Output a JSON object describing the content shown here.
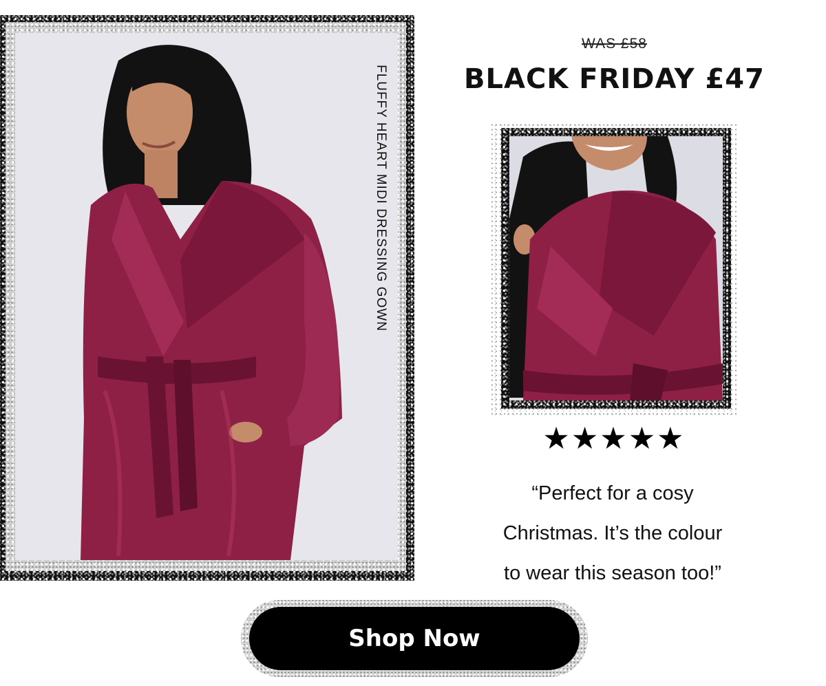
{
  "product": {
    "vertical_label": "FLUFFY HEART MIDI DRESSING GOWN",
    "main_image_alt": "Woman wearing a berry-red fluffy hooded dressing gown",
    "detail_image_alt": "Close-up of the fluffy hooded dressing gown"
  },
  "pricing": {
    "was": "WAS £58",
    "now": "BLACK FRIDAY £47"
  },
  "review": {
    "rating": 5,
    "max_rating": 5,
    "stars": [
      "★",
      "★",
      "★",
      "★",
      "★"
    ],
    "quote_lines": [
      "“Perfect for a cosy",
      "Christmas. It’s the colour",
      "to wear this season too!”"
    ]
  },
  "cta": {
    "label": "Shop Now"
  },
  "colors": {
    "gown": "#8e1f45",
    "gown_dark": "#5e0f2c",
    "gown_light": "#b23a63",
    "hair": "#121212",
    "skin": "#c58c6b",
    "backdrop": "#e6e6ec",
    "button": "#000000",
    "button_text": "#ffffff"
  }
}
